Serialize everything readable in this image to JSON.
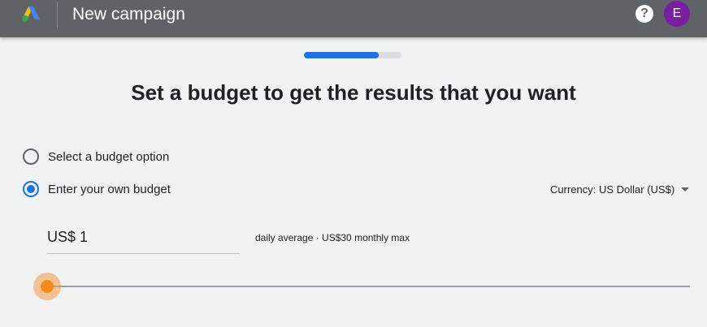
{
  "header": {
    "app_title": "New campaign",
    "help_icon": "help-icon",
    "help_glyph": "?",
    "avatar_initial": "E",
    "avatar_color": "#7b1fa2",
    "bar_color": "#5f6368"
  },
  "progress": {
    "fraction": 0.77,
    "color": "#1a73e8"
  },
  "main": {
    "heading": "Set a budget to get the results that you want",
    "options": [
      {
        "label": "Select a budget option",
        "checked": false
      },
      {
        "label": "Enter your own budget",
        "checked": true
      }
    ],
    "currency": "Currency: US Dollar (US$)",
    "budget_value": "US$ 1",
    "budget_note": "daily average · US$30 monthly max",
    "slider": {
      "value_fraction": 0.0,
      "thumb_color": "#f28c17"
    }
  }
}
